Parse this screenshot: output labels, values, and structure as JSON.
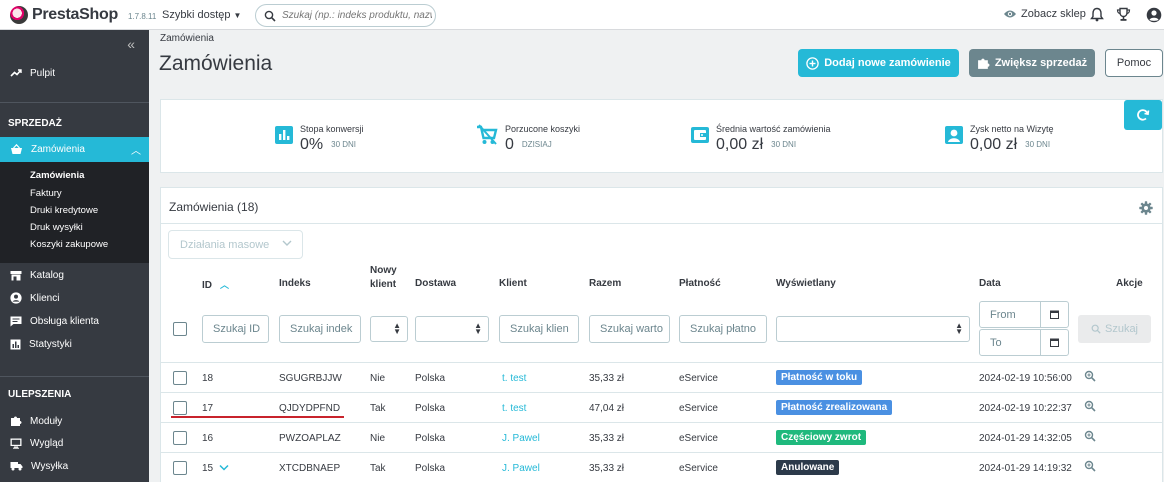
{
  "header": {
    "logo_text": "PrestaShop",
    "version": "1.7.8.11",
    "quick_access": "Szybki dostęp",
    "search_placeholder": "Szukaj (np.: indeks produktu, nazwa k",
    "see_shop": "Zobacz sklep"
  },
  "sidebar": {
    "dashboard": "Pulpit",
    "section_sales": "SPRZEDAŻ",
    "orders": "Zamówienia",
    "orders_sub": [
      "Zamówienia",
      "Faktury",
      "Druki kredytowe",
      "Druk wysyłki",
      "Koszyki zakupowe"
    ],
    "catalog": "Katalog",
    "customers": "Klienci",
    "customer_service": "Obsługa klienta",
    "stats": "Statystyki",
    "section_improve": "ULEPSZENIA",
    "modules": "Moduły",
    "design": "Wygląd",
    "shipping": "Wysyłka"
  },
  "page": {
    "breadcrumb": "Zamówienia",
    "title": "Zamówienia",
    "add_order": "Dodaj nowe zamówienie",
    "increase_sales": "Zwiększ sprzedaż",
    "help": "Pomoc"
  },
  "kpis": [
    {
      "label": "Stopa konwersji",
      "value": "0%",
      "period": "30 DNI",
      "icon": "chart-icon"
    },
    {
      "label": "Porzucone koszyki",
      "value": "0",
      "period": "DZISIAJ",
      "icon": "cart-off-icon"
    },
    {
      "label": "Średnia wartość zamówienia",
      "value": "0,00 zł",
      "period": "30 DNI",
      "icon": "wallet-icon"
    },
    {
      "label": "Zysk netto na Wizytę",
      "value": "0,00 zł",
      "period": "30 DNI",
      "icon": "user-icon"
    }
  ],
  "orders": {
    "title": "Zamówienia (18)",
    "bulk_actions": "Działania masowe",
    "columns": {
      "id": "ID",
      "reference": "Indeks",
      "new_client_1": "Nowy",
      "new_client_2": "klient",
      "delivery": "Dostawa",
      "customer": "Klient",
      "total": "Razem",
      "payment": "Płatność",
      "status": "Wyświetlany",
      "date": "Data",
      "actions": "Akcje"
    },
    "filters": {
      "id": "Szukaj ID",
      "reference": "Szukaj indek",
      "customer": "Szukaj klien",
      "total": "Szukaj warto",
      "payment": "Szukaj płatno",
      "date_from": "From",
      "date_to": "To",
      "search_button": "Szukaj"
    },
    "rows": [
      {
        "id": "18",
        "reference": "SGUGRBJJW",
        "new": "Nie",
        "country": "Polska",
        "customer": "t. test",
        "total": "35,33 zł",
        "payment": "eService",
        "status": "Płatność w toku",
        "status_color": "#4a90e2",
        "date": "2024-02-19 10:56:00"
      },
      {
        "id": "17",
        "reference": "QJDYDPFND",
        "new": "Tak",
        "country": "Polska",
        "customer": "t. test",
        "total": "47,04 zł",
        "payment": "eService",
        "status": "Płatność zrealizowana",
        "status_color": "#4a90e2",
        "date": "2024-02-19 10:22:37"
      },
      {
        "id": "16",
        "reference": "PWZOAPLAZ",
        "new": "Nie",
        "country": "Polska",
        "customer": "J. Pawel",
        "total": "35,33 zł",
        "payment": "eService",
        "status": "Częściowy zwrot",
        "status_color": "#1fb97d",
        "date": "2024-01-29 14:32:05"
      },
      {
        "id": "15",
        "reference": "XTCDBNAEP",
        "new": "Tak",
        "country": "Polska",
        "customer": "J. Pawel",
        "total": "35,33 zł",
        "payment": "eService",
        "status": "Anulowane",
        "status_color": "#2c3a4a",
        "date": "2024-01-29 14:19:32"
      }
    ]
  },
  "colors": {
    "accent": "#25b9d7",
    "sidebar": "#363a41",
    "annotation": "#c8232c"
  }
}
